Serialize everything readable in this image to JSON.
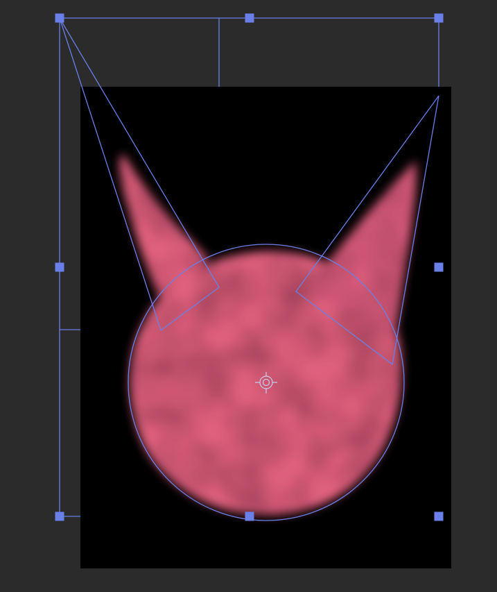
{
  "viewer": {
    "background_color": "#2b2b2b",
    "canvas_color": "#000000"
  },
  "shape": {
    "type": "cat-head mask",
    "fill_color": "#e0607e",
    "blur": "soft"
  },
  "overlay": {
    "stroke_color": "#6a80e8",
    "handle_color": "#6a80e8",
    "pivot_icon": "crosshair-pivot-icon"
  }
}
